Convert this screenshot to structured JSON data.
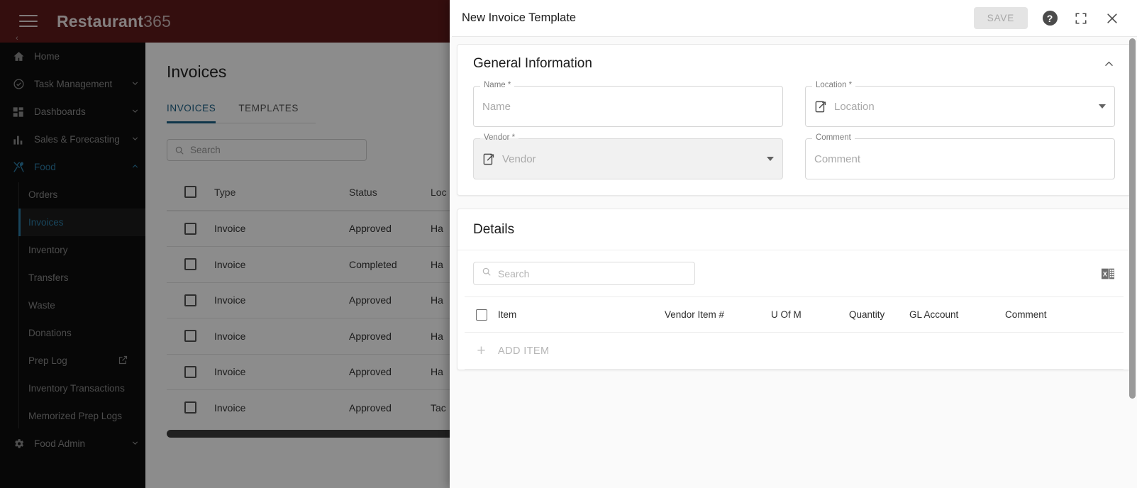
{
  "app": {
    "brand_bold": "Restaurant",
    "brand_light": "365",
    "menu_icon": "hamburger-icon"
  },
  "sidebar": {
    "items": [
      {
        "label": "Home",
        "icon": "home-icon",
        "chevron": "",
        "type": "link"
      },
      {
        "label": "Task Management",
        "icon": "check-circle-icon",
        "chevron": "⌄",
        "type": "group"
      },
      {
        "label": "Dashboards",
        "icon": "dashboard-icon",
        "chevron": "⌄",
        "type": "group"
      },
      {
        "label": "Sales & Forecasting",
        "icon": "bar-chart-icon",
        "chevron": "⌄",
        "type": "group"
      },
      {
        "label": "Food",
        "icon": "food-icon",
        "chevron": "⌃",
        "type": "group-open"
      }
    ],
    "sub_items": [
      {
        "label": "Orders",
        "external": false
      },
      {
        "label": "Invoices",
        "external": false,
        "selected": true
      },
      {
        "label": "Inventory",
        "external": false
      },
      {
        "label": "Transfers",
        "external": false
      },
      {
        "label": "Waste",
        "external": false
      },
      {
        "label": "Donations",
        "external": false
      },
      {
        "label": "Prep Log",
        "external": true
      },
      {
        "label": "Inventory Transactions",
        "external": false
      },
      {
        "label": "Memorized Prep Logs",
        "external": false
      }
    ],
    "footer_item": {
      "label": "Food Admin",
      "icon": "gear-icon",
      "chevron": "⌄"
    }
  },
  "page": {
    "title": "Invoices",
    "tabs": [
      {
        "label": "INVOICES",
        "active": true
      },
      {
        "label": "TEMPLATES",
        "active": false
      }
    ],
    "search_placeholder": "Search",
    "table": {
      "columns": [
        "Type",
        "Status",
        "Loc"
      ],
      "rows": [
        {
          "type": "Invoice",
          "status": "Approved",
          "location": "Ha"
        },
        {
          "type": "Invoice",
          "status": "Completed",
          "location": "Ha"
        },
        {
          "type": "Invoice",
          "status": "Approved",
          "location": "Ha"
        },
        {
          "type": "Invoice",
          "status": "Approved",
          "location": "Ha"
        },
        {
          "type": "Invoice",
          "status": "Approved",
          "location": "Ha"
        },
        {
          "type": "Invoice",
          "status": "Approved",
          "location": "Tac"
        }
      ]
    }
  },
  "modal": {
    "title": "New Invoice Template",
    "save_label": "SAVE",
    "help_glyph": "?",
    "icons": {
      "help": "help-icon",
      "fullscreen": "fullscreen-icon",
      "close": "close-icon"
    },
    "general": {
      "section_title": "General Information",
      "fields": [
        {
          "label": "Name *",
          "placeholder": "Name",
          "kind": "text",
          "disabled": false,
          "has_link_icon": false
        },
        {
          "label": "Location *",
          "placeholder": "Location",
          "kind": "select",
          "disabled": false,
          "has_link_icon": true
        },
        {
          "label": "Vendor *",
          "placeholder": "Vendor",
          "kind": "select",
          "disabled": true,
          "has_link_icon": true
        },
        {
          "label": "Comment",
          "placeholder": "Comment",
          "kind": "text",
          "disabled": false,
          "has_link_icon": false
        }
      ]
    },
    "details": {
      "section_title": "Details",
      "search_placeholder": "Search",
      "export_icon": "excel-export-icon",
      "columns": [
        "Item",
        "Vendor Item #",
        "U Of M",
        "Quantity",
        "GL Account",
        "Comment"
      ],
      "add_item_label": "ADD ITEM",
      "add_item_icon": "plus-icon"
    }
  },
  "colors": {
    "brand_bar": "#601b1b",
    "sidebar": "#0d0d0d",
    "accent": "#2d7fa8",
    "tab_active": "#1d6287"
  }
}
